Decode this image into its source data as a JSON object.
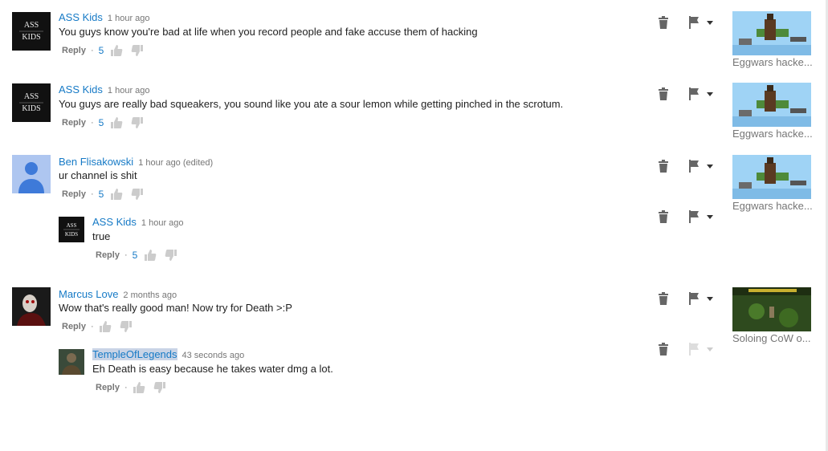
{
  "comments": [
    {
      "author": "ASS Kids",
      "time": "1 hour ago",
      "text": "You guys know you're bad at life when you record people and fake accuse them of hacking",
      "reply_label": "Reply",
      "likes": "5",
      "video_title": "Eggwars hacke..."
    },
    {
      "author": "ASS Kids",
      "time": "1 hour ago",
      "text": "You guys are really bad squeakers, you sound like you ate a sour lemon while getting pinched in the scrotum.",
      "reply_label": "Reply",
      "likes": "5",
      "video_title": "Eggwars hacke..."
    },
    {
      "author": "Ben Flisakowski",
      "time": "1 hour ago (edited)",
      "text": "ur channel is shit",
      "reply_label": "Reply",
      "likes": "5",
      "video_title": "Eggwars hacke..."
    },
    {
      "author": "ASS Kids",
      "time": "1 hour ago",
      "text": "true",
      "reply_label": "Reply",
      "likes": "5"
    },
    {
      "author": "Marcus Love",
      "time": "2 months ago",
      "text": "Wow that's really good man! Now try for Death >:P",
      "reply_label": "Reply",
      "likes": "",
      "video_title": "Soloing CoW o..."
    },
    {
      "author": "TempleOfLegends",
      "time": "43 seconds ago",
      "text": "Eh Death is easy because he takes water dmg a lot.",
      "reply_label": "Reply",
      "likes": ""
    }
  ],
  "avatar_text": {
    "line1": "ASS",
    "line2": "KIDS"
  },
  "colors": {
    "link": "#167ac6",
    "meta": "#767676",
    "icon": "#666666"
  }
}
